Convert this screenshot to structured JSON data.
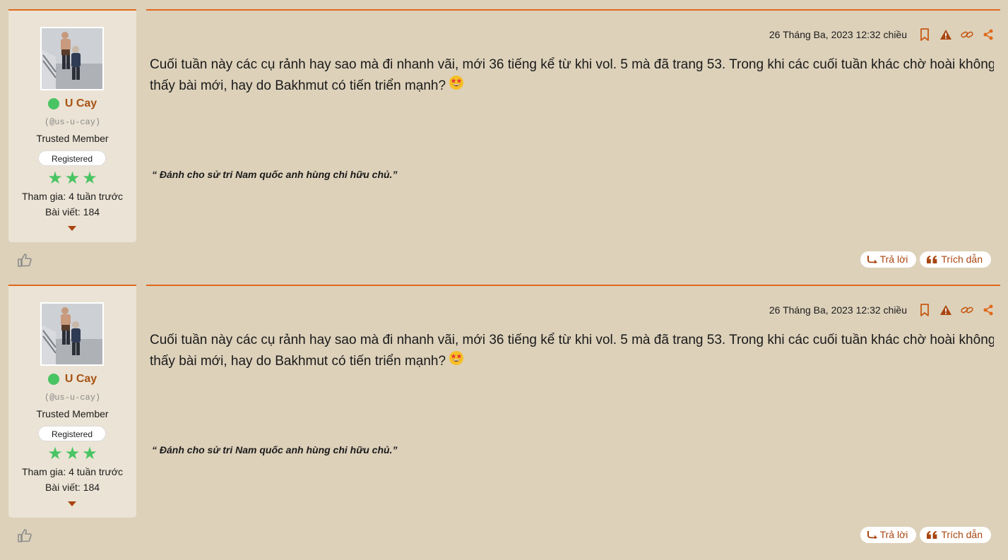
{
  "colors": {
    "accent": "#e0691a",
    "accent_dark": "#a8450f",
    "page_bg": "#ddd1ba",
    "card_bg": "#ebe3d5",
    "online": "#49c463"
  },
  "posts": [
    {
      "user": {
        "name": "U Cay",
        "handle": "(@us-u-cay)",
        "title": "Trusted Member",
        "badge": "Registered",
        "stars": 3,
        "joined": "Tham gia: 4 tuần trước",
        "post_count": "Bài viết: 184"
      },
      "date": "26 Tháng Ba, 2023 12:32 chiều",
      "icons": [
        "bookmark-icon",
        "report-icon",
        "link-icon",
        "share-icon"
      ],
      "body_line1": "Cuối tuần này các cụ rảnh hay sao mà đi nhanh vãi, mới 36 tiếng kể từ khi vol. 5 mà đã trang 53. Trong khi các cuối tuần khác chờ hoài không",
      "body_line2": "thấy bài mới, hay do Bakhmut có tiến triển mạnh?",
      "signature": "“ Đánh cho sử tri Nam quốc anh hùng chi hữu chủ.”",
      "reply_label": "Trả lời",
      "quote_label": "Trích dẫn"
    },
    {
      "user": {
        "name": "U Cay",
        "handle": "(@us-u-cay)",
        "title": "Trusted Member",
        "badge": "Registered",
        "stars": 3,
        "joined": "Tham gia: 4 tuần trước",
        "post_count": "Bài viết: 184"
      },
      "date": "26 Tháng Ba, 2023 12:32 chiều",
      "icons": [
        "bookmark-icon",
        "report-icon",
        "link-icon",
        "share-icon"
      ],
      "body_line1": "Cuối tuần này các cụ rảnh hay sao mà đi nhanh vãi, mới 36 tiếng kể từ khi vol. 5 mà đã trang 53. Trong khi các cuối tuần khác chờ hoài không",
      "body_line2": "thấy bài mới, hay do Bakhmut có tiến triển mạnh?",
      "signature": "“ Đánh cho sử tri Nam quốc anh hùng chi hữu chủ.”",
      "reply_label": "Trả lời",
      "quote_label": "Trích dẫn"
    }
  ]
}
